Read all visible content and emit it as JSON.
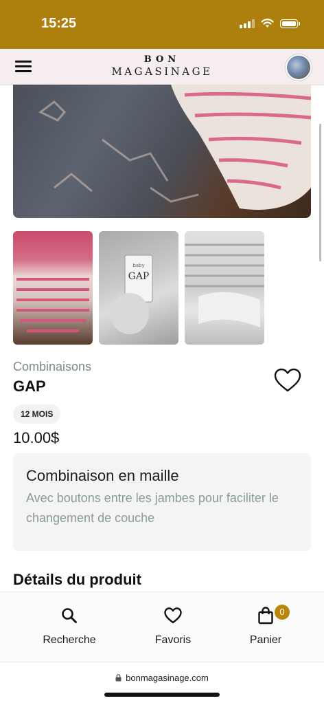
{
  "status": {
    "time": "15:25"
  },
  "header": {
    "logo_line1": "BON",
    "logo_line2": "MAGASINAGE"
  },
  "product": {
    "category": "Combinaisons",
    "brand": "GAP",
    "size": "12 MOIS",
    "price": "10.00$",
    "title": "Combinaison en maille",
    "description": "Avec boutons entre les jambes pour faciliter le changement de couche",
    "details_heading": "Détails du produit"
  },
  "tabbar": {
    "search_label": "Recherche",
    "favorites_label": "Favoris",
    "cart_label": "Panier",
    "cart_count": "0"
  },
  "browser": {
    "url": "bonmagasinage.com"
  },
  "colors": {
    "accent": "#ad7f0c",
    "badge": "#b8860b"
  }
}
